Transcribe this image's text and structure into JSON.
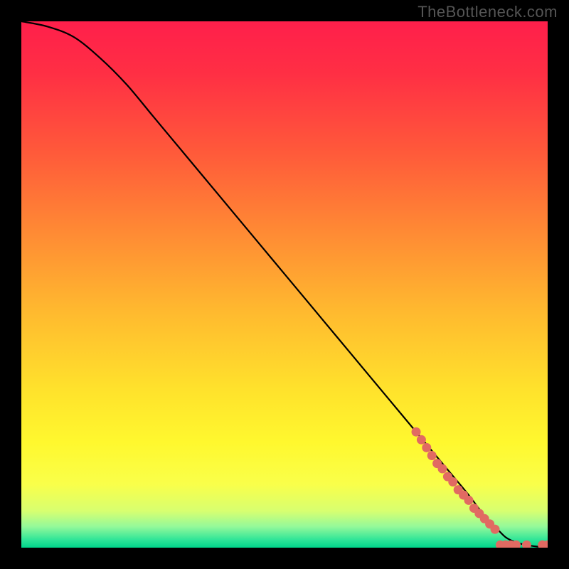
{
  "watermark": "TheBottleneck.com",
  "chart_data": {
    "type": "line",
    "title": "",
    "xlabel": "",
    "ylabel": "",
    "xlim": [
      0,
      100
    ],
    "ylim": [
      0,
      100
    ],
    "curve": {
      "comment": "Smooth descending curve from top-left to bottom-right; values read off plot grid (percent of axis range)",
      "x": [
        0,
        5,
        10,
        15,
        20,
        25,
        30,
        35,
        40,
        45,
        50,
        55,
        60,
        65,
        70,
        75,
        80,
        85,
        88,
        90,
        92,
        94,
        96,
        98,
        100
      ],
      "y": [
        100,
        99,
        97,
        93,
        88,
        82,
        76,
        70,
        64,
        58,
        52,
        46,
        40,
        34,
        28,
        22,
        16,
        10,
        6,
        4,
        2,
        1,
        0.5,
        0.2,
        0
      ]
    },
    "markers": {
      "comment": "Salmon-colored dot markers clustered along the lower-right portion of the curve",
      "color": "#e16a62",
      "points": [
        {
          "x": 75,
          "y": 22
        },
        {
          "x": 76,
          "y": 20.5
        },
        {
          "x": 77,
          "y": 19
        },
        {
          "x": 78,
          "y": 17.5
        },
        {
          "x": 79,
          "y": 16
        },
        {
          "x": 80,
          "y": 15
        },
        {
          "x": 81,
          "y": 13.5
        },
        {
          "x": 82,
          "y": 12.5
        },
        {
          "x": 83,
          "y": 11
        },
        {
          "x": 84,
          "y": 10
        },
        {
          "x": 85,
          "y": 9
        },
        {
          "x": 86,
          "y": 7.5
        },
        {
          "x": 87,
          "y": 6.5
        },
        {
          "x": 88,
          "y": 5.5
        },
        {
          "x": 89,
          "y": 4.5
        },
        {
          "x": 90,
          "y": 3.5
        },
        {
          "x": 91,
          "y": 0.5
        },
        {
          "x": 92,
          "y": 0.5
        },
        {
          "x": 93,
          "y": 0.5
        },
        {
          "x": 94,
          "y": 0.5
        },
        {
          "x": 96,
          "y": 0.5
        },
        {
          "x": 99,
          "y": 0.5
        },
        {
          "x": 100,
          "y": 0.5
        }
      ]
    },
    "gradient_stops": [
      {
        "offset": 0.0,
        "color": "#ff1f4b"
      },
      {
        "offset": 0.1,
        "color": "#ff2f44"
      },
      {
        "offset": 0.25,
        "color": "#ff5a3a"
      },
      {
        "offset": 0.4,
        "color": "#ff8a34"
      },
      {
        "offset": 0.55,
        "color": "#ffb92f"
      },
      {
        "offset": 0.7,
        "color": "#ffe22c"
      },
      {
        "offset": 0.8,
        "color": "#fff82e"
      },
      {
        "offset": 0.88,
        "color": "#f9ff4a"
      },
      {
        "offset": 0.93,
        "color": "#d8ff70"
      },
      {
        "offset": 0.96,
        "color": "#94f99a"
      },
      {
        "offset": 0.985,
        "color": "#2fe598"
      },
      {
        "offset": 1.0,
        "color": "#00d58a"
      }
    ]
  }
}
